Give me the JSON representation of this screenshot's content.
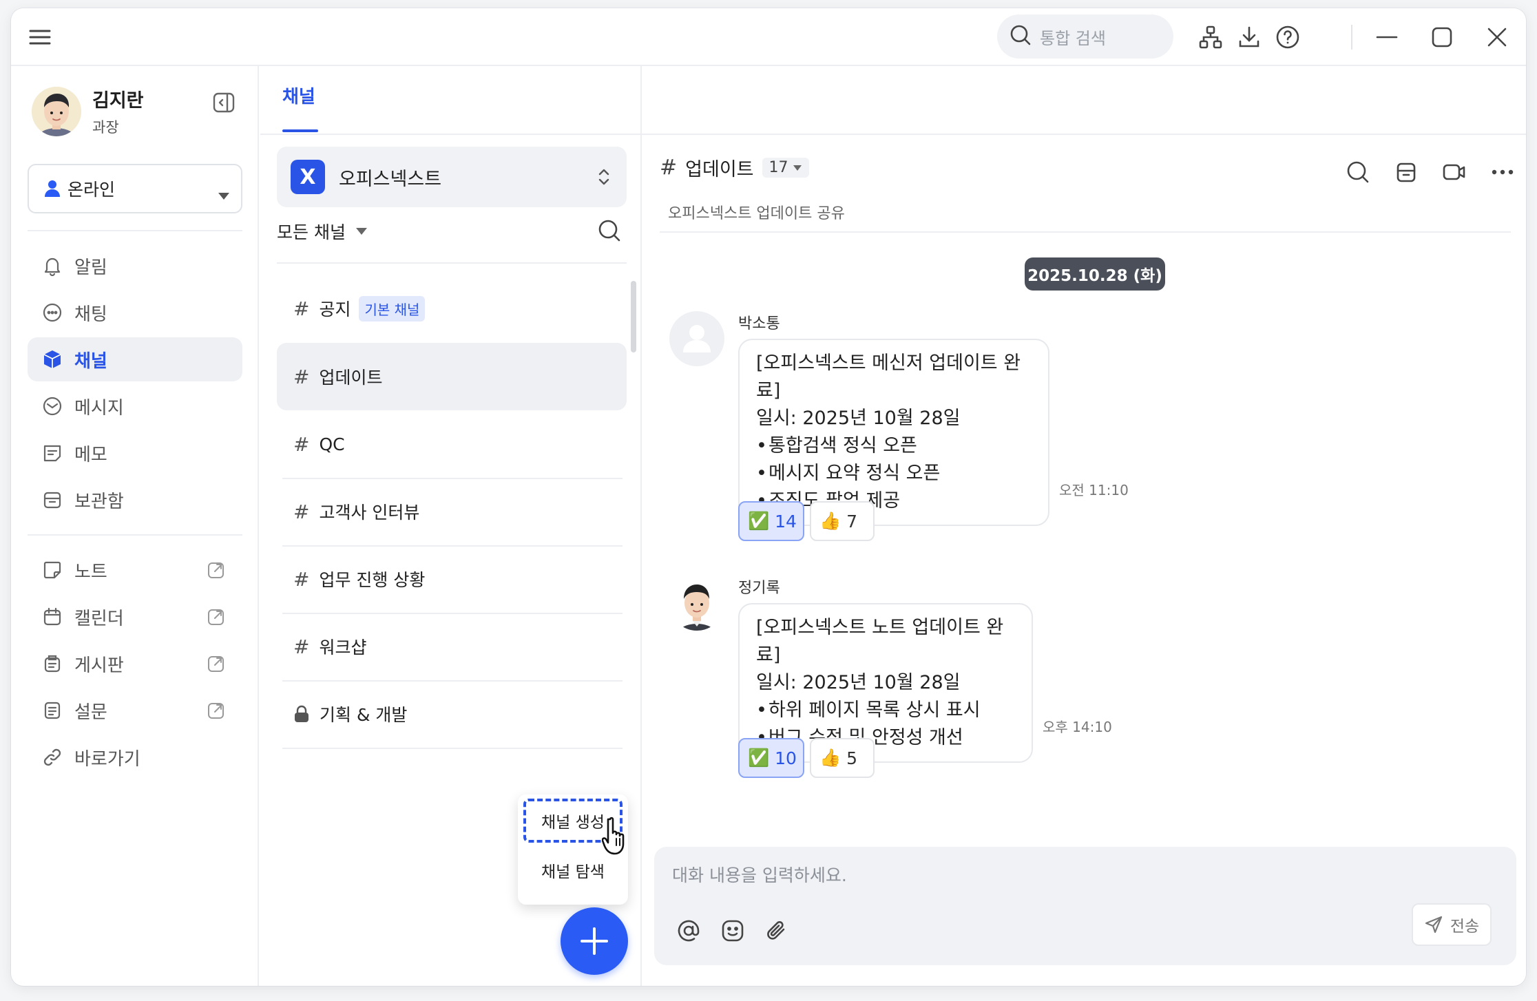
{
  "search": {
    "placeholder": "통합 검색"
  },
  "profile": {
    "name": "김지란",
    "rank": "과장",
    "status": "온라인"
  },
  "nav": {
    "alarm": "알림",
    "chat": "채팅",
    "channel": "채널",
    "message": "메시지",
    "memo": "메모",
    "archive": "보관함",
    "note": "노트",
    "calendar": "캘린더",
    "board": "게시판",
    "survey": "설문",
    "shortcut": "바로가기"
  },
  "tabs": {
    "channel": "채널"
  },
  "workspace": {
    "name": "오피스넥스트",
    "logo": "X"
  },
  "channel_filter": "모든 채널",
  "channels": [
    {
      "name": "공지",
      "badge": "기본 채널"
    },
    {
      "name": "업데이트"
    },
    {
      "name": "QC"
    },
    {
      "name": "고객사 인터뷰"
    },
    {
      "name": "업무 진행 상황"
    },
    {
      "name": "워크샵"
    },
    {
      "name": "기획 & 개발"
    }
  ],
  "popup_menu": {
    "create": "채널 생성",
    "explore": "채널 탐색"
  },
  "chat": {
    "channel_name": "업데이트",
    "member_count": "17",
    "description": "오피스넥스트 업데이트 공유",
    "date": "2025.10.28 (화)",
    "messages": [
      {
        "sender": "박소통",
        "title": "[오피스넥스트 메신저 업데이트 완료]",
        "date_line": "일시: 2025년 10월 28일",
        "bullets": [
          "통합검색 정식 오픈",
          "메시지 요약 정식 오픈",
          "조직도 팝업 제공"
        ],
        "time": "오전 11:10",
        "reactions": [
          {
            "emoji": "✅",
            "count": "14"
          },
          {
            "emoji": "👍",
            "count": "7"
          }
        ]
      },
      {
        "sender": "정기록",
        "title": "[오피스넥스트 노트 업데이트 완료]",
        "date_line": "일시: 2025년 10월 28일",
        "bullets": [
          "하위 페이지 목록 상시 표시",
          "버그 수정 및 안정성 개선"
        ],
        "time": "오후 14:10",
        "reactions": [
          {
            "emoji": "✅",
            "count": "10"
          },
          {
            "emoji": "👍",
            "count": "5"
          }
        ]
      }
    ],
    "composer_placeholder": "대화 내용을 입력하세요.",
    "send_label": "전송"
  },
  "colors": {
    "accent": "#2a54e6",
    "fab": "#2a5cf5",
    "date_pill": "#4a4f5a"
  }
}
